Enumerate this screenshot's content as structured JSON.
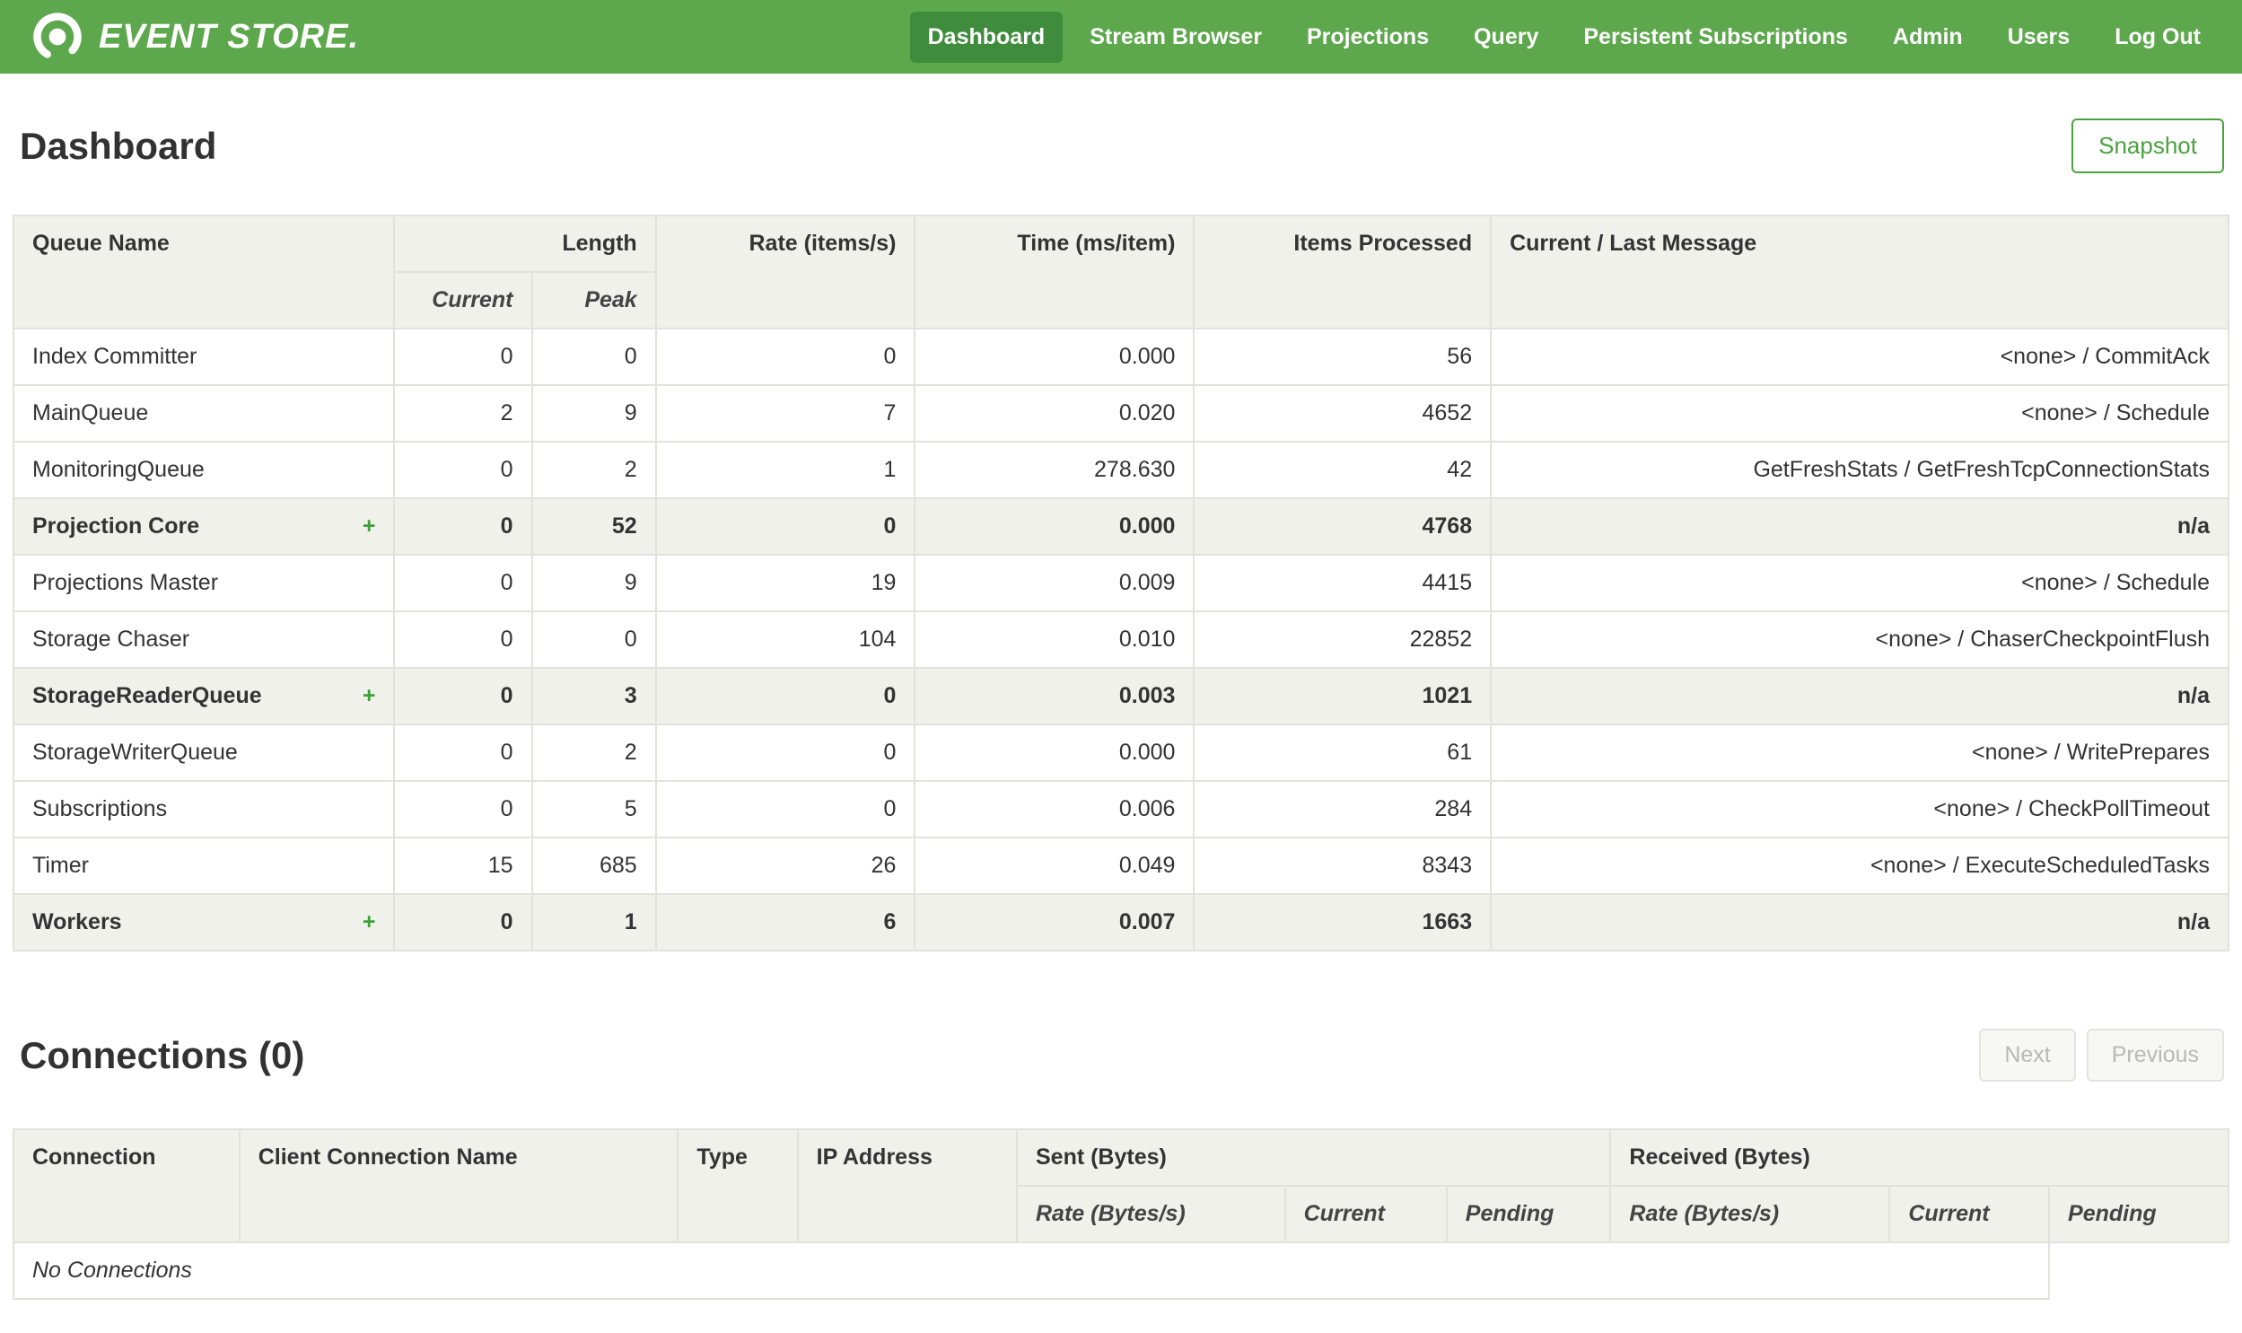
{
  "nav": {
    "brand": "EVENT STORE.",
    "items": [
      {
        "label": "Dashboard",
        "active": true
      },
      {
        "label": "Stream Browser",
        "active": false
      },
      {
        "label": "Projections",
        "active": false
      },
      {
        "label": "Query",
        "active": false
      },
      {
        "label": "Persistent Subscriptions",
        "active": false
      },
      {
        "label": "Admin",
        "active": false
      },
      {
        "label": "Users",
        "active": false
      },
      {
        "label": "Log Out",
        "active": false
      }
    ]
  },
  "page": {
    "title": "Dashboard",
    "snapshot_label": "Snapshot"
  },
  "queues": {
    "headers": {
      "queue_name": "Queue Name",
      "length": "Length",
      "current": "Current",
      "peak": "Peak",
      "rate": "Rate (items/s)",
      "time": "Time (ms/item)",
      "items_processed": "Items Processed",
      "message": "Current / Last Message"
    },
    "rows": [
      {
        "name": "Index Committer",
        "expand": "",
        "current": "0",
        "peak": "0",
        "rate": "0",
        "time": "0.000",
        "items": "56",
        "message": "<none> / CommitAck"
      },
      {
        "name": "MainQueue",
        "expand": "",
        "current": "2",
        "peak": "9",
        "rate": "7",
        "time": "0.020",
        "items": "4652",
        "message": "<none> / Schedule"
      },
      {
        "name": "MonitoringQueue",
        "expand": "",
        "current": "0",
        "peak": "2",
        "rate": "1",
        "time": "278.630",
        "items": "42",
        "message": "GetFreshStats / GetFreshTcpConnectionStats"
      },
      {
        "name": "Projection Core",
        "expand": "+",
        "current": "0",
        "peak": "52",
        "rate": "0",
        "time": "0.000",
        "items": "4768",
        "message": "n/a"
      },
      {
        "name": "Projections Master",
        "expand": "",
        "current": "0",
        "peak": "9",
        "rate": "19",
        "time": "0.009",
        "items": "4415",
        "message": "<none> / Schedule"
      },
      {
        "name": "Storage Chaser",
        "expand": "",
        "current": "0",
        "peak": "0",
        "rate": "104",
        "time": "0.010",
        "items": "22852",
        "message": "<none> / ChaserCheckpointFlush"
      },
      {
        "name": "StorageReaderQueue",
        "expand": "+",
        "current": "0",
        "peak": "3",
        "rate": "0",
        "time": "0.003",
        "items": "1021",
        "message": "n/a"
      },
      {
        "name": "StorageWriterQueue",
        "expand": "",
        "current": "0",
        "peak": "2",
        "rate": "0",
        "time": "0.000",
        "items": "61",
        "message": "<none> / WritePrepares"
      },
      {
        "name": "Subscriptions",
        "expand": "",
        "current": "0",
        "peak": "5",
        "rate": "0",
        "time": "0.006",
        "items": "284",
        "message": "<none> / CheckPollTimeout"
      },
      {
        "name": "Timer",
        "expand": "",
        "current": "15",
        "peak": "685",
        "rate": "26",
        "time": "0.049",
        "items": "8343",
        "message": "<none> / ExecuteScheduledTasks"
      },
      {
        "name": "Workers",
        "expand": "+",
        "current": "0",
        "peak": "1",
        "rate": "6",
        "time": "0.007",
        "items": "1663",
        "message": "n/a"
      }
    ]
  },
  "connections": {
    "title": "Connections (0)",
    "next_label": "Next",
    "previous_label": "Previous",
    "headers": {
      "connection": "Connection",
      "client_name": "Client Connection Name",
      "type": "Type",
      "ip": "IP Address",
      "sent": "Sent (Bytes)",
      "received": "Received (Bytes)",
      "rate": "Rate (Bytes/s)",
      "current": "Current",
      "pending": "Pending"
    },
    "empty_message": "No Connections"
  },
  "colors": {
    "navbar_green": "#5da74c",
    "active_green": "#3e8c3c",
    "accent_green": "#4aa23f"
  }
}
